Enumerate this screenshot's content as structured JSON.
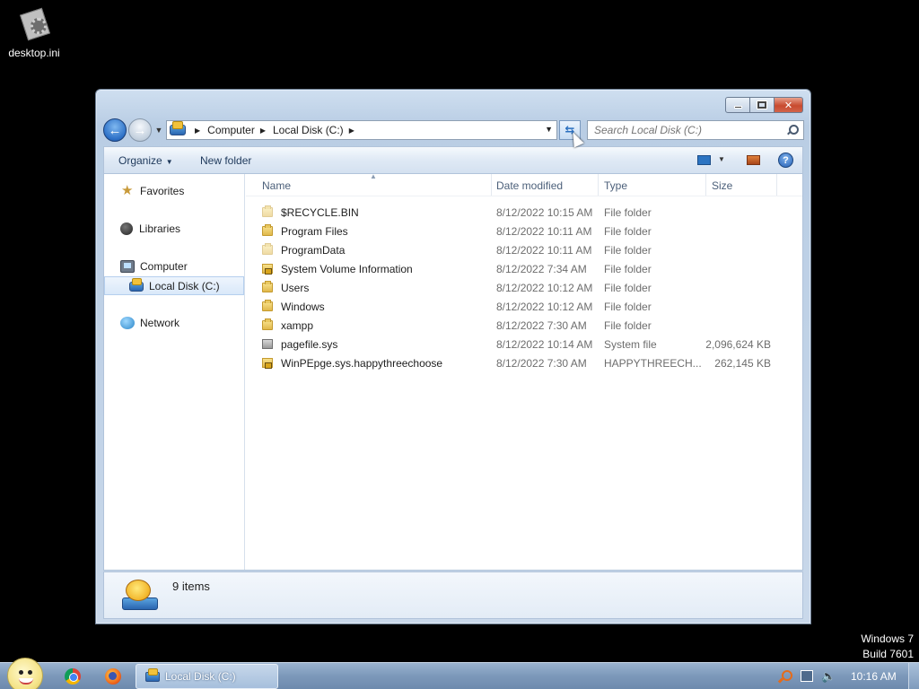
{
  "desktop": {
    "icons": [
      {
        "label": "desktop.ini",
        "icon": "settings-file-icon"
      }
    ],
    "watermark": {
      "line1": "Windows 7",
      "line2": "Build 7601"
    }
  },
  "window": {
    "caption_buttons": {
      "minimize": "minimize",
      "maximize": "maximize",
      "close": "✕"
    },
    "nav": {
      "back": "←",
      "forward": "→",
      "breadcrumb": [
        "Computer",
        "Local Disk (C:)"
      ],
      "search_placeholder": "Search Local Disk (C:)"
    },
    "toolbar": {
      "organize": "Organize",
      "new_folder": "New folder",
      "help": "?"
    },
    "navpane": {
      "favorites": "Favorites",
      "libraries": "Libraries",
      "computer": "Computer",
      "local_disk": "Local Disk (C:)",
      "network": "Network"
    },
    "columns": {
      "name": "Name",
      "date": "Date modified",
      "type": "Type",
      "size": "Size"
    },
    "files": [
      {
        "name": "$RECYCLE.BIN",
        "date": "8/12/2022 10:15 AM",
        "type": "File folder",
        "size": "",
        "icon": "folder-icon"
      },
      {
        "name": "Program Files",
        "date": "8/12/2022 10:11 AM",
        "type": "File folder",
        "size": "",
        "icon": "folder-icon"
      },
      {
        "name": "ProgramData",
        "date": "8/12/2022 10:11 AM",
        "type": "File folder",
        "size": "",
        "icon": "folder-icon"
      },
      {
        "name": "System Volume Information",
        "date": "8/12/2022 7:34 AM",
        "type": "File folder",
        "size": "",
        "icon": "locked-folder-icon"
      },
      {
        "name": "Users",
        "date": "8/12/2022 10:12 AM",
        "type": "File folder",
        "size": "",
        "icon": "folder-icon"
      },
      {
        "name": "Windows",
        "date": "8/12/2022 10:12 AM",
        "type": "File folder",
        "size": "",
        "icon": "folder-icon"
      },
      {
        "name": "xampp",
        "date": "8/12/2022 7:30 AM",
        "type": "File folder",
        "size": "",
        "icon": "folder-icon"
      },
      {
        "name": "pagefile.sys",
        "date": "8/12/2022 10:14 AM",
        "type": "System file",
        "size": "2,096,624 KB",
        "icon": "system-file-icon"
      },
      {
        "name": "WinPEpge.sys.happythreechoose",
        "date": "8/12/2022 7:30 AM",
        "type": "HAPPYTHREECH...",
        "size": "262,145 KB",
        "icon": "locked-file-icon"
      }
    ],
    "details": {
      "count": "9 items"
    }
  },
  "taskbar": {
    "active_task": "Local Disk (C:)",
    "clock": "10:16 AM"
  }
}
